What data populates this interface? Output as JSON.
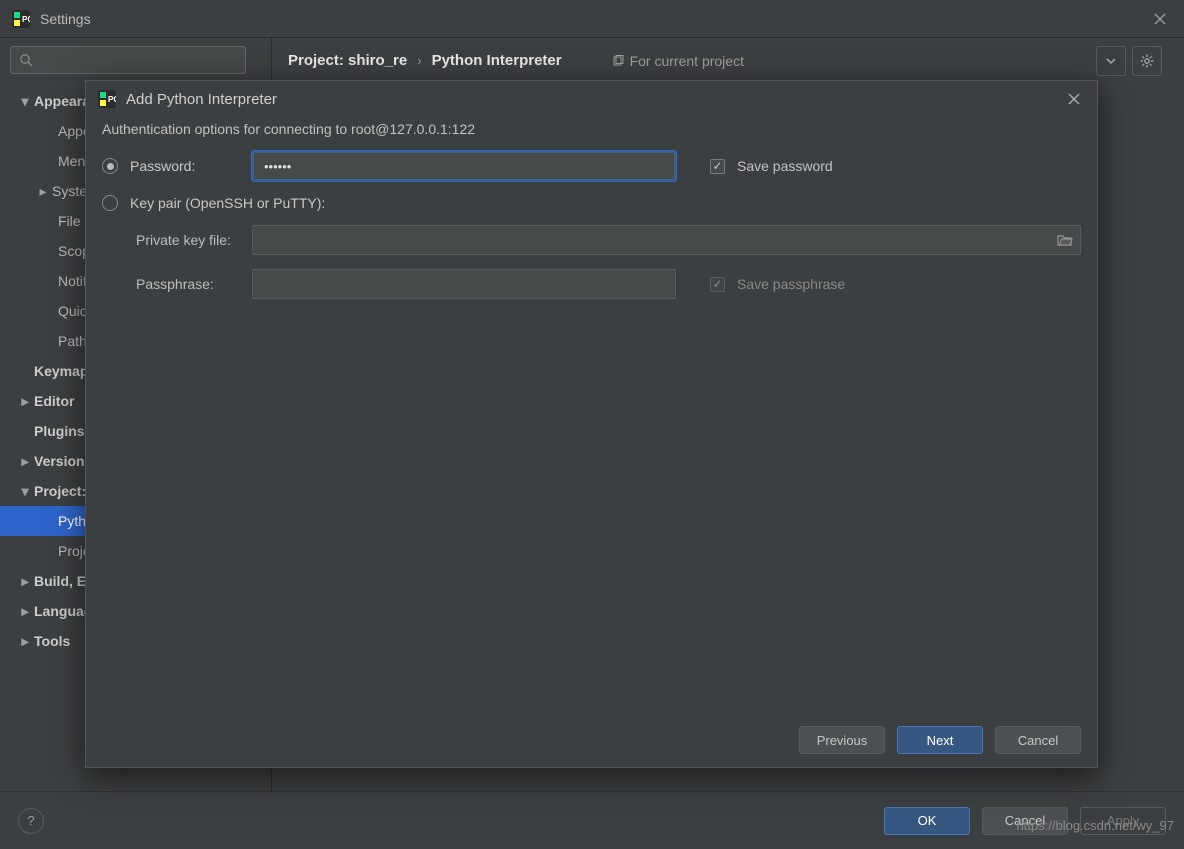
{
  "settings": {
    "window_title": "Settings",
    "breadcrumb1": "Project: shiro_re",
    "breadcrumb_sep": "›",
    "breadcrumb2": "Python Interpreter",
    "hint": "For current project",
    "tree": [
      {
        "label": "Appearance & Behavior",
        "twisty": "v",
        "bold": true,
        "lvl": 0
      },
      {
        "label": "Appearance",
        "lvl": 2
      },
      {
        "label": "Menus and Toolbars",
        "lvl": 2
      },
      {
        "label": "System Settings",
        "twisty": ">",
        "lvl": 1
      },
      {
        "label": "File Colors",
        "lvl": 2
      },
      {
        "label": "Scopes",
        "lvl": 2
      },
      {
        "label": "Notifications",
        "lvl": 2
      },
      {
        "label": "Quick Lists",
        "lvl": 2
      },
      {
        "label": "Path Variables",
        "lvl": 2
      },
      {
        "label": "Keymap",
        "bold": true,
        "lvl": 0
      },
      {
        "label": "Editor",
        "twisty": ">",
        "bold": true,
        "lvl": 0
      },
      {
        "label": "Plugins",
        "bold": true,
        "lvl": 0
      },
      {
        "label": "Version Control",
        "twisty": ">",
        "bold": true,
        "lvl": 0
      },
      {
        "label": "Project: shiro_re",
        "twisty": "v",
        "bold": true,
        "lvl": 0
      },
      {
        "label": "Python Interpreter",
        "lvl": 2,
        "selected": true
      },
      {
        "label": "Project Structure",
        "lvl": 2
      },
      {
        "label": "Build, Execution, Deployment",
        "twisty": ">",
        "bold": true,
        "lvl": 0
      },
      {
        "label": "Languages & Frameworks",
        "twisty": ">",
        "bold": true,
        "lvl": 0
      },
      {
        "label": "Tools",
        "twisty": ">",
        "bold": true,
        "lvl": 0
      }
    ],
    "footer": {
      "ok": "OK",
      "cancel": "Cancel",
      "apply": "Apply",
      "help": "?"
    }
  },
  "dialog": {
    "title": "Add Python Interpreter",
    "auth_text": "Authentication options for connecting to root@127.0.0.1:122",
    "password_label": "Password:",
    "password_value": "••••••",
    "save_password_label": "Save password",
    "keypair_label": "Key pair (OpenSSH or PuTTY):",
    "private_key_label": "Private key file:",
    "private_key_value": "",
    "passphrase_label": "Passphrase:",
    "passphrase_value": "",
    "save_passphrase_label": "Save passphrase",
    "buttons": {
      "previous": "Previous",
      "next": "Next",
      "cancel": "Cancel"
    }
  },
  "watermark": "https://blog.csdn.net/wy_97"
}
